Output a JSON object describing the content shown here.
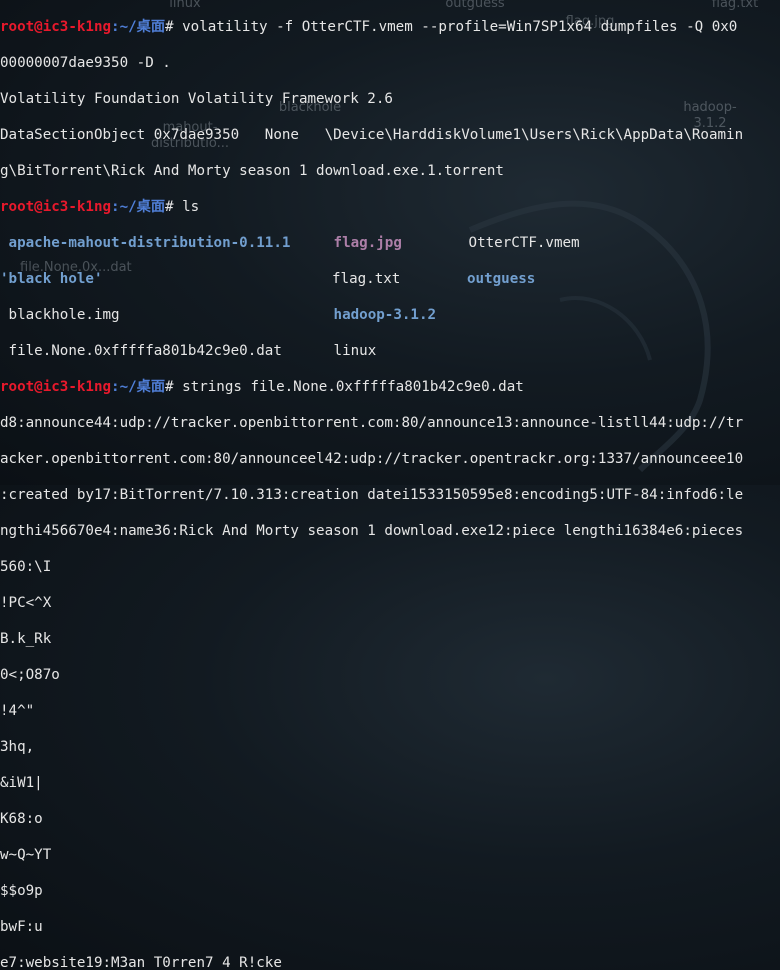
{
  "desktop": {
    "icons": [
      {
        "label": "linux"
      },
      {
        "label": "outguess"
      },
      {
        "label": "flag.txt"
      },
      {
        "label": "flag.jpg"
      },
      {
        "label": "blackhole"
      },
      {
        "label": "mahout-distributio..."
      },
      {
        "label": "hadoop-3.1.2"
      },
      {
        "label": "file.None.0x...dat"
      }
    ]
  },
  "terminal": {
    "prompt_user": "root@ic3-k1ng",
    "prompt_path": ":~/桌面",
    "prompt_symbol": "# ",
    "cmd1": "volatility -f OtterCTF.vmem --profile=Win7SP1x64 dumpfiles -Q 0x0",
    "cmd1_cont": "00000007dae9350 -D .",
    "out1": [
      "Volatility Foundation Volatility Framework 2.6",
      "DataSectionObject 0x7dae9350   None   \\Device\\HarddiskVolume1\\Users\\Rick\\AppData\\Roamin",
      "g\\BitTorrent\\Rick And Morty season 1 download.exe.1.torrent"
    ],
    "cmd2": "ls",
    "ls": {
      "r1": [
        "apache-mahout-distribution-0.11.1",
        "flag.jpg",
        "OtterCTF.vmem"
      ],
      "r2": [
        "'black hole'",
        "flag.txt",
        "outguess"
      ],
      "r3": [
        "blackhole.img",
        "hadoop-3.1.2",
        ""
      ],
      "r4": [
        "file.None.0xfffffa801b42c9e0.dat",
        "linux",
        ""
      ]
    },
    "cmd3": "strings file.None.0xfffffa801b42c9e0.dat",
    "out3": [
      "d8:announce44:udp://tracker.openbittorrent.com:80/announce13:announce-listll44:udp://tr",
      "acker.openbittorrent.com:80/announceel42:udp://tracker.opentrackr.org:1337/announceee10",
      ":created by17:BitTorrent/7.10.313:creation datei1533150595e8:encoding5:UTF-84:infod6:le",
      "ngthi456670e4:name36:Rick And Morty season 1 download.exe12:piece lengthi16384e6:pieces",
      "560:\\I",
      "!PC<^X",
      "B.k_Rk",
      "0<;O87o",
      "!4^\"",
      "3hq,",
      "&iW1|",
      "K68:o",
      "w~Q~YT",
      "$$o9p",
      "bwF:u",
      "e7:website19:M3an_T0rren7_4_R!cke"
    ]
  }
}
